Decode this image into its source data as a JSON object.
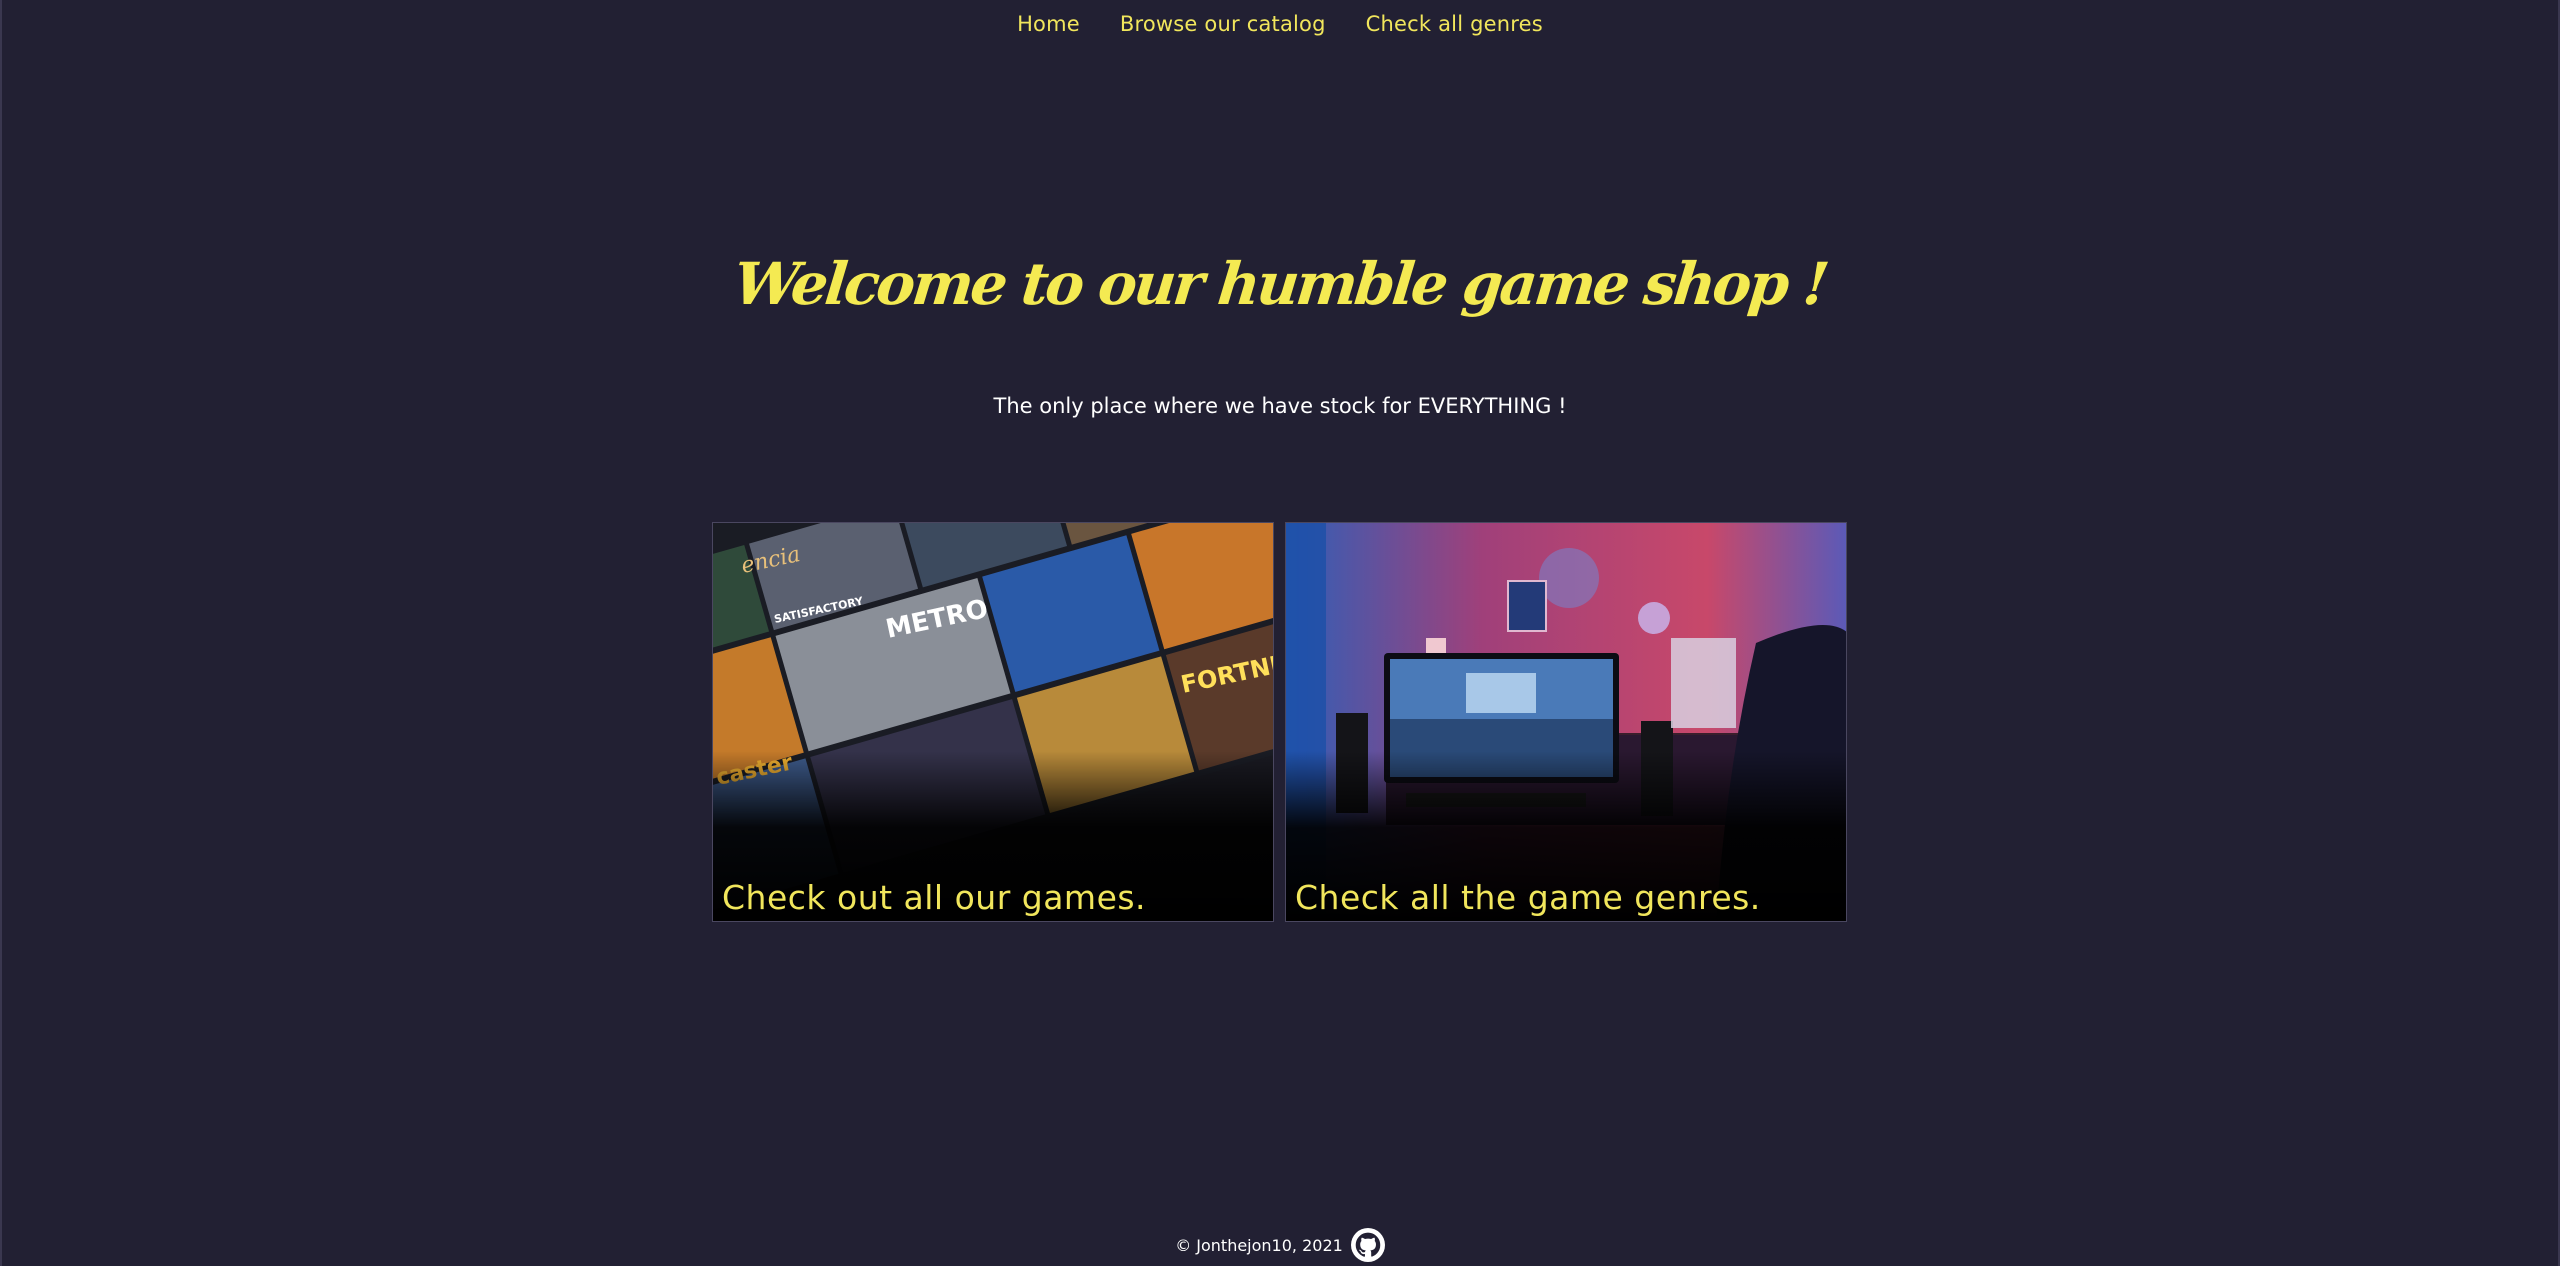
{
  "nav": {
    "items": [
      {
        "label": "Home"
      },
      {
        "label": "Browse our catalog"
      },
      {
        "label": "Check all genres"
      }
    ]
  },
  "hero": {
    "title": "Welcome to our humble game shop !",
    "subtitle": "The only place where we have stock for EVERYTHING !"
  },
  "cards": [
    {
      "caption": "Check out all our games."
    },
    {
      "caption": "Check all the game genres."
    }
  ],
  "footer": {
    "copyright": "© Jonthejon10, 2021",
    "icon": "github-icon"
  },
  "colors": {
    "background": "#222033",
    "accent": "#f1e65c",
    "text": "#ffffff"
  }
}
